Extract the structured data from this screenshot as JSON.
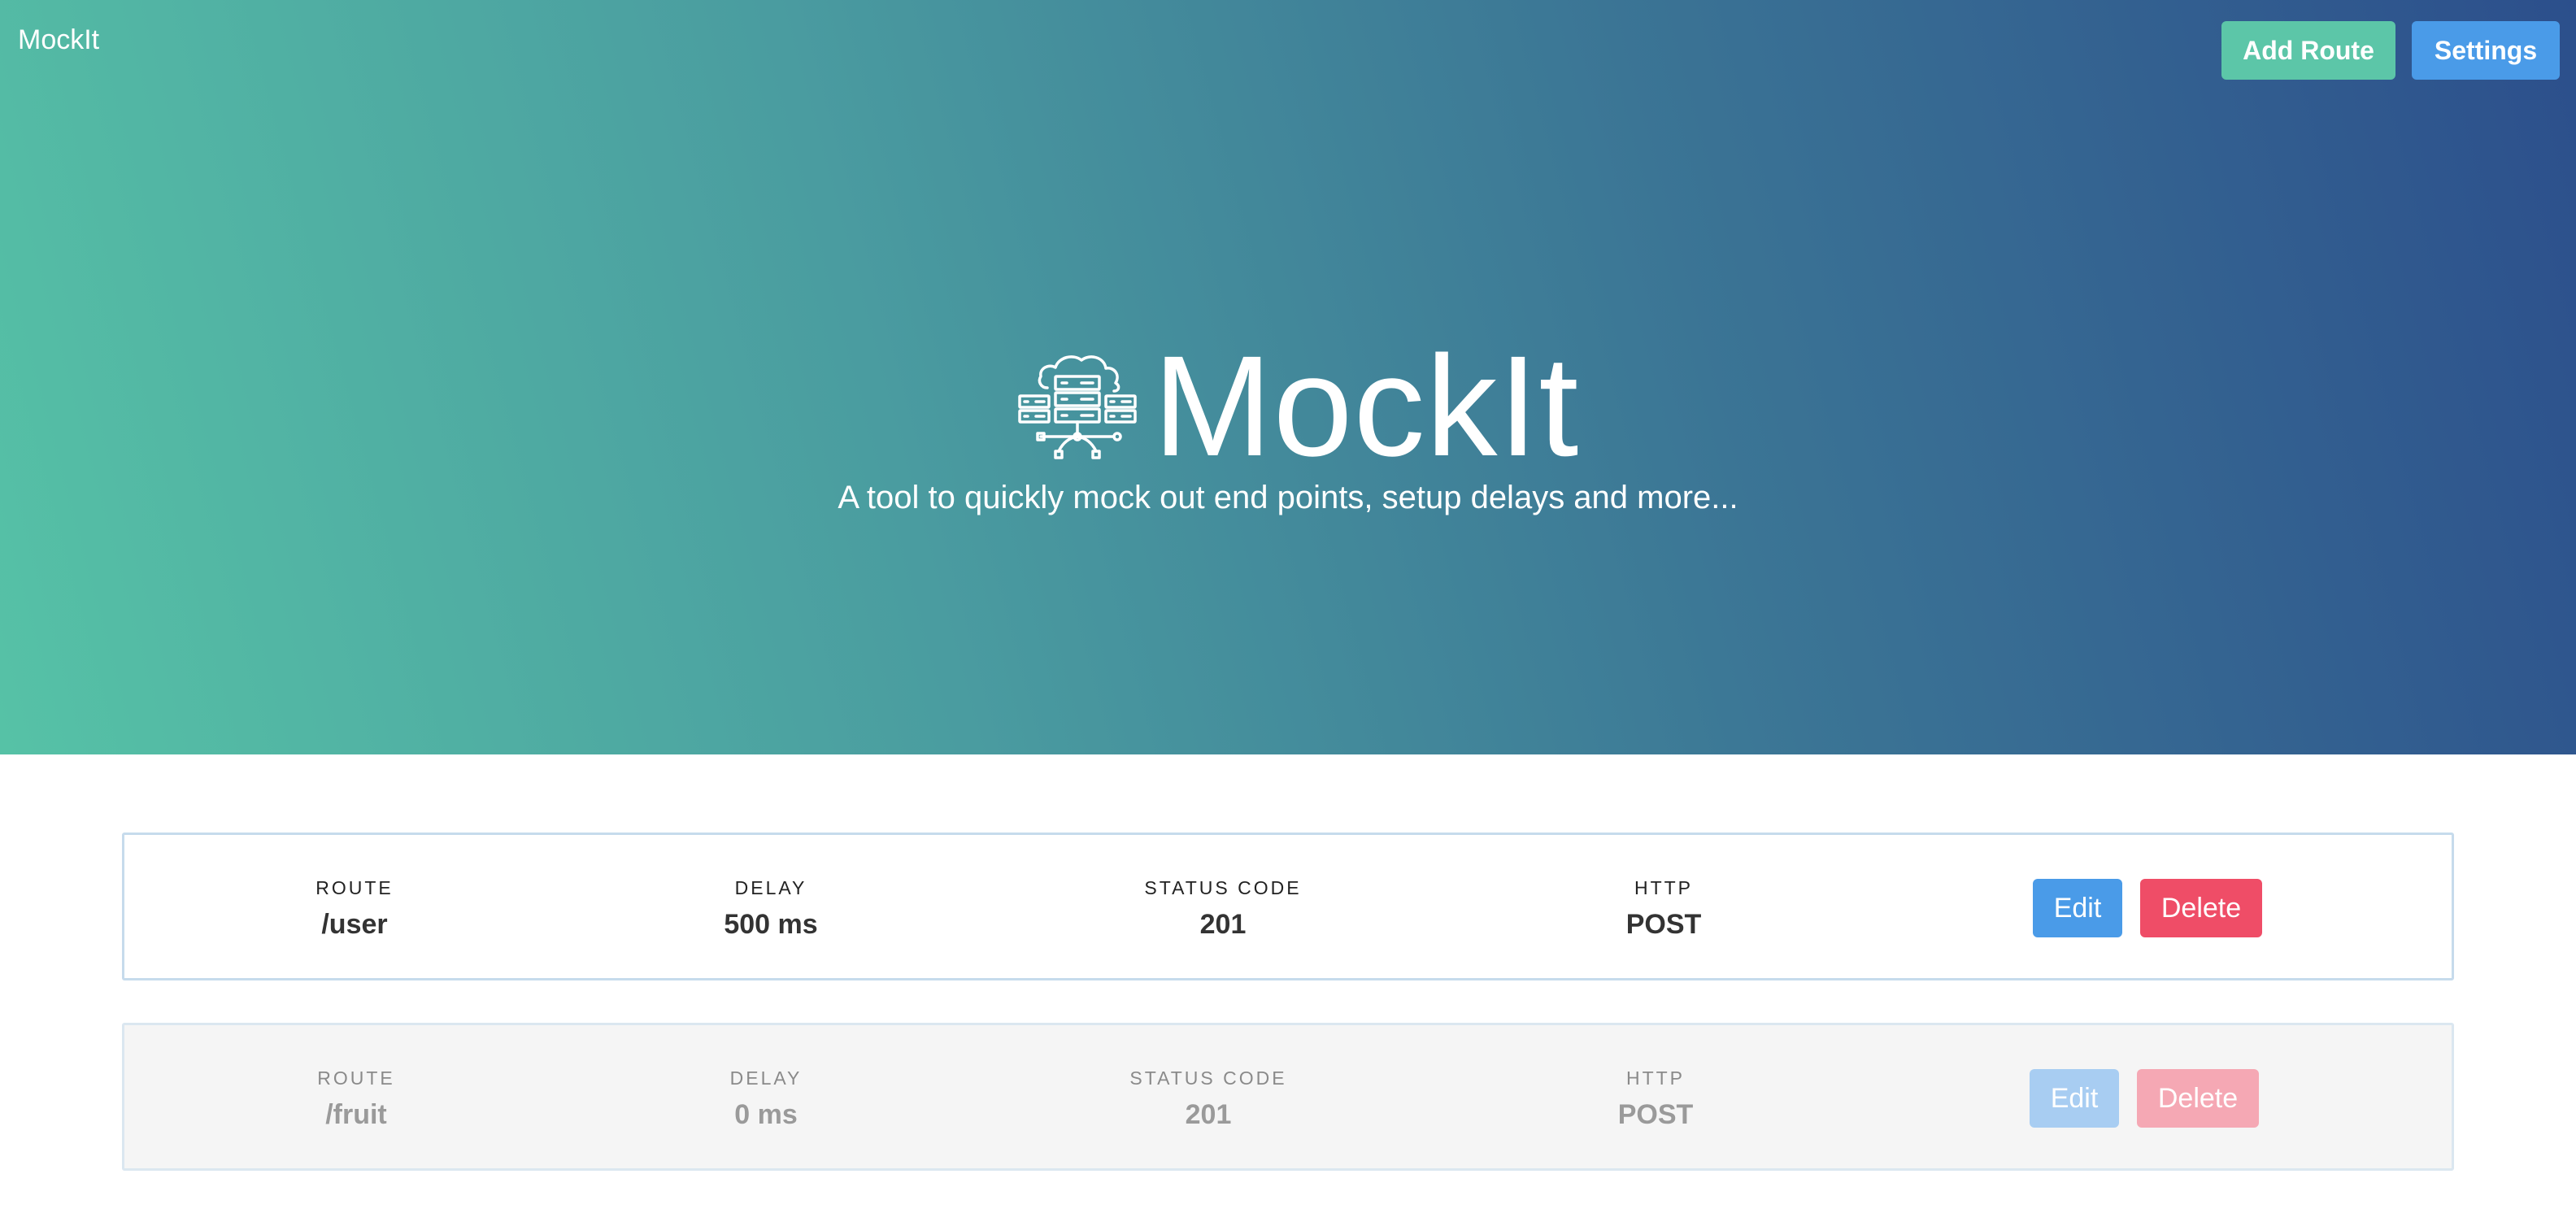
{
  "header": {
    "brand": "MockIt",
    "add_route_label": "Add Route",
    "settings_label": "Settings"
  },
  "hero": {
    "title": "MockIt",
    "logo_icon": "cloud-server-network-icon",
    "tagline": "A tool to quickly mock out end points, setup delays and more..."
  },
  "routes": [
    {
      "route_label": "ROUTE",
      "route": "/user",
      "delay_label": "DELAY",
      "delay": "500 ms",
      "status_label": "STATUS CODE",
      "status": "201",
      "http_label": "HTTP",
      "http": "POST",
      "edit_label": "Edit",
      "delete_label": "Delete",
      "enabled": true
    },
    {
      "route_label": "ROUTE",
      "route": "/fruit",
      "delay_label": "DELAY",
      "delay": "0 ms",
      "status_label": "STATUS CODE",
      "status": "201",
      "http_label": "HTTP",
      "http": "POST",
      "edit_label": "Edit",
      "delete_label": "Delete",
      "enabled": false
    }
  ],
  "colors": {
    "hero_start": "#56c2a6",
    "hero_end": "#2c4f8c",
    "add_button": "#5cc6a8",
    "primary": "#4a9be8",
    "danger": "#ef4d67"
  }
}
